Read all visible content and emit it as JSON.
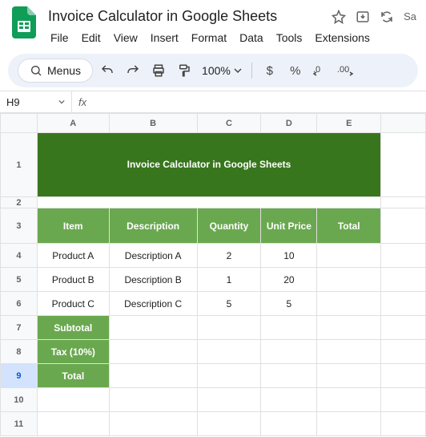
{
  "doc": {
    "title": "Invoice Calculator in Google Sheets"
  },
  "menu": {
    "file": "File",
    "edit": "Edit",
    "view": "View",
    "insert": "Insert",
    "format": "Format",
    "data": "Data",
    "tools": "Tools",
    "extensions": "Extensions"
  },
  "toolbar": {
    "menus": "Menus",
    "zoom": "100%",
    "currency": "$",
    "percent": "%"
  },
  "namebox": {
    "cell": "H9",
    "fx": "fx"
  },
  "cols": [
    "A",
    "B",
    "C",
    "D",
    "E"
  ],
  "rows": [
    "1",
    "2",
    "3",
    "4",
    "5",
    "6",
    "7",
    "8",
    "9",
    "10",
    "11"
  ],
  "sheet": {
    "title": "Invoice Calculator in Google Sheets",
    "headers": {
      "item": "Item",
      "desc": "Description",
      "qty": "Quantity",
      "price": "Unit Price",
      "total": "Total"
    },
    "r4": {
      "a": "Product A",
      "b": "Description A",
      "c": "2",
      "d": "10"
    },
    "r5": {
      "a": "Product B",
      "b": "Description B",
      "c": "1",
      "d": "20"
    },
    "r6": {
      "a": "Product C",
      "b": "Description C",
      "c": "5",
      "d": "5"
    },
    "r7a": "Subtotal",
    "r8a": "Tax (10%)",
    "r9a": "Total"
  },
  "chart_data": {
    "type": "table",
    "title": "Invoice Calculator in Google Sheets",
    "columns": [
      "Item",
      "Description",
      "Quantity",
      "Unit Price",
      "Total"
    ],
    "rows": [
      [
        "Product A",
        "Description A",
        2,
        10,
        null
      ],
      [
        "Product B",
        "Description B",
        1,
        20,
        null
      ],
      [
        "Product C",
        "Description C",
        5,
        5,
        null
      ]
    ],
    "summary": {
      "Subtotal": null,
      "Tax (10%)": null,
      "Total": null
    }
  }
}
